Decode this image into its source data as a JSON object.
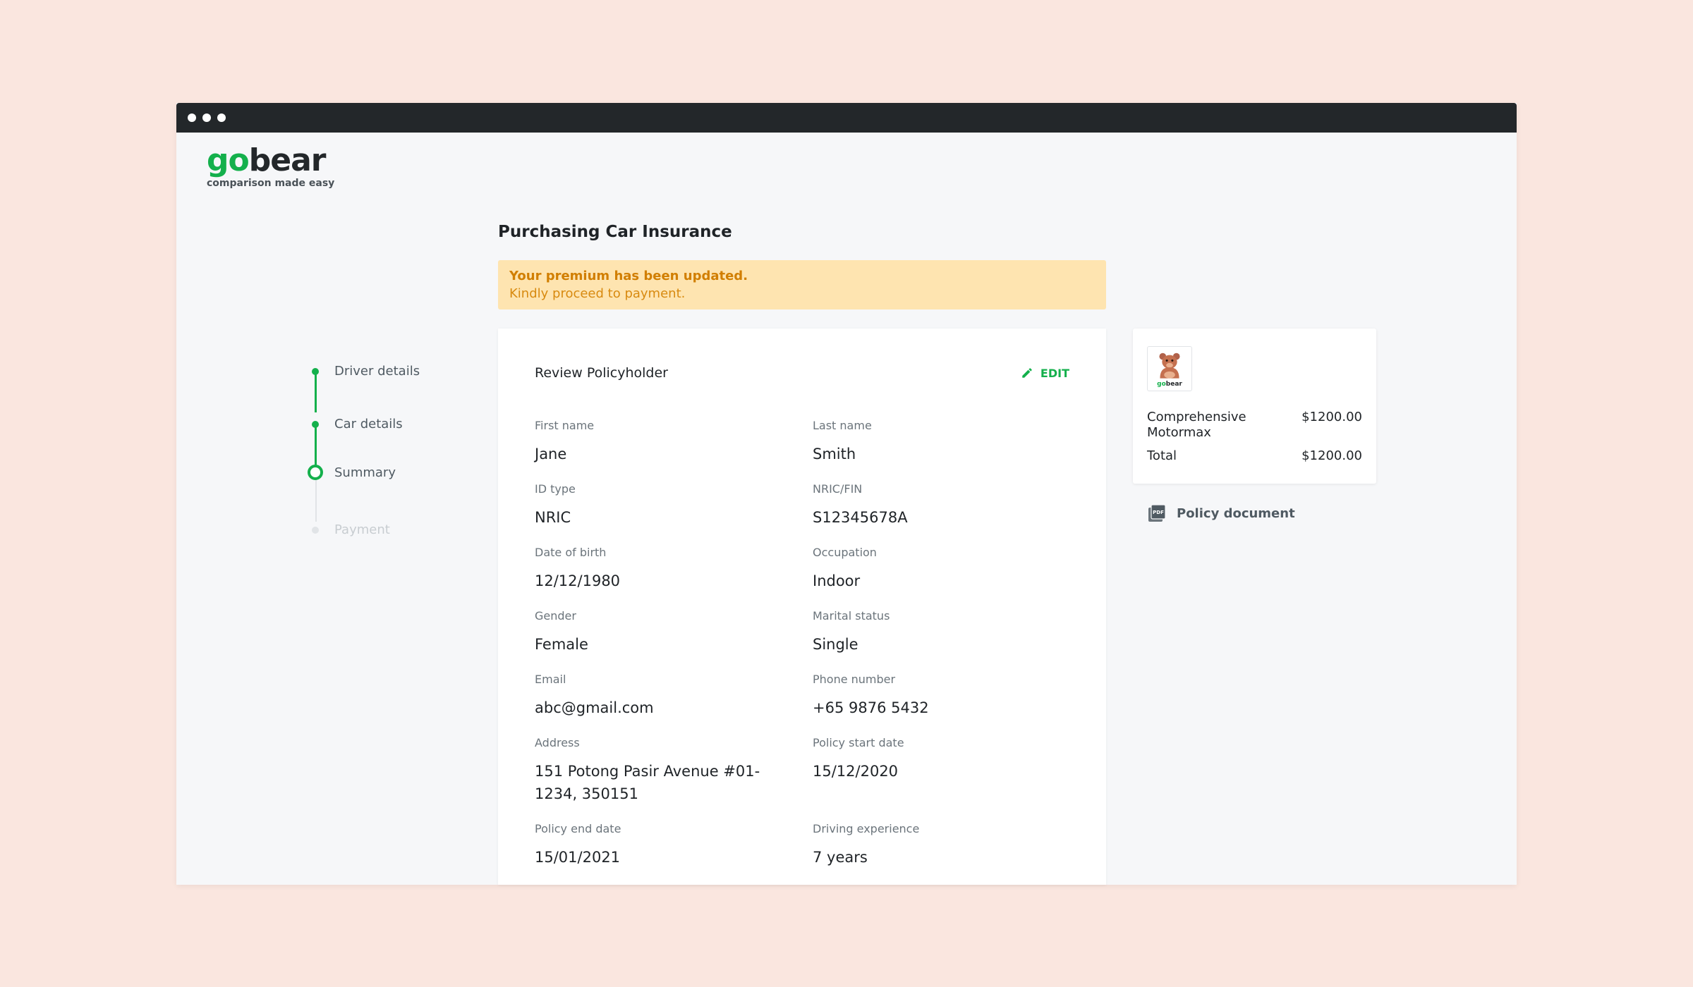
{
  "window": {
    "dots": 3
  },
  "logo": {
    "go": "go",
    "bear": "bear",
    "tagline": "comparison made easy"
  },
  "stepper": {
    "steps": [
      {
        "label": "Driver details",
        "state": "done"
      },
      {
        "label": "Car details",
        "state": "done"
      },
      {
        "label": "Summary",
        "state": "active"
      },
      {
        "label": "Payment",
        "state": "pending"
      }
    ]
  },
  "page": {
    "title": "Purchasing Car Insurance"
  },
  "banner": {
    "title": "Your premium has been updated.",
    "text": "Kindly proceed to payment."
  },
  "review": {
    "title": "Review Policyholder",
    "edit_label": "EDIT",
    "fields": {
      "first_name": {
        "label": "First name",
        "value": "Jane"
      },
      "last_name": {
        "label": "Last name",
        "value": "Smith"
      },
      "id_type": {
        "label": "ID type",
        "value": "NRIC"
      },
      "nric": {
        "label": "NRIC/FIN",
        "value": "S12345678A"
      },
      "dob": {
        "label": "Date of birth",
        "value": "12/12/1980"
      },
      "occupation": {
        "label": "Occupation",
        "value": "Indoor"
      },
      "gender": {
        "label": "Gender",
        "value": "Female"
      },
      "marital": {
        "label": "Marital status",
        "value": "Single"
      },
      "email": {
        "label": "Email",
        "value": "abc@gmail.com"
      },
      "phone": {
        "label": "Phone number",
        "value": "+65 9876 5432"
      },
      "address": {
        "label": "Address",
        "value": "151 Potong Pasir Avenue #01-1234, 350151"
      },
      "policy_start": {
        "label": "Policy start date",
        "value": "15/12/2020"
      },
      "policy_end": {
        "label": "Policy end date",
        "value": "15/01/2021"
      },
      "driving_exp": {
        "label": "Driving experience",
        "value": "7 years"
      }
    }
  },
  "summary": {
    "logo_text": "gobear",
    "product_name": "Comprehensive Motormax",
    "product_price": "$1200.00",
    "total_label": "Total",
    "total_price": "$1200.00",
    "pdf_badge": "PDF",
    "policy_document": "Policy document"
  },
  "colors": {
    "brand_green": "#14b04c",
    "banner_bg": "#fee4b0",
    "banner_text": "#d17e00",
    "page_bg": "#fae6df"
  }
}
